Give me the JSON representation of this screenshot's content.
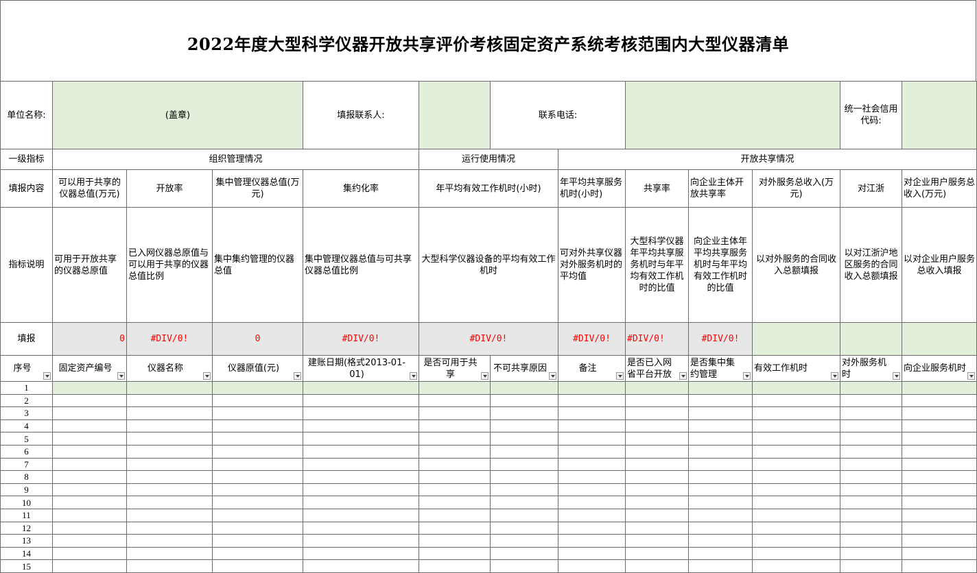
{
  "title": "2022年度大型科学仪器开放共享评价考核固定资产系统考核范围内大型仪器清单",
  "info_row": {
    "unit_label": "单位名称:",
    "stamp": "(盖章)",
    "contact_label": "填报联系人:",
    "phone_label": "联系电话:",
    "credit_label": "统一社会信用代码:"
  },
  "level1": {
    "label": "一级指标",
    "org": "组织管理情况",
    "ops": "运行使用情况",
    "share": "开放共享情况"
  },
  "content": {
    "label": "填报内容",
    "c1": "可以用于共享的仪器总值(万元)",
    "c2": "开放率",
    "c3": "集中管理仪器总值(万元)",
    "c4": "集约化率",
    "c5": "年平均有效工作机时(小时)",
    "c6": "年平均共享服务机时(小时)",
    "c7": "共享率",
    "c8": "向企业主体开放共享率",
    "c9": "对外服务总收入(万元)",
    "c10": "对江浙",
    "c11": "对企业用户服务总收入(万元)"
  },
  "explain": {
    "label": "指标说明",
    "c1": "可用于开放共享的仪器总原值",
    "c2": "已入网仪器总原值与可以用于共享的仪器总值比例",
    "c3": "集中集约管理的仪器总值",
    "c4": "集中管理仪器总值与可共享仪器总值比例",
    "c5": "大型科学仪器设备的平均有效工作机时",
    "c6": "可对外共享仪器对外服务机时的平均值",
    "c7": "大型科学仪器年平均共享服务机时与年平均有效工作机时的比值",
    "c8": "向企业主体年平均共享服务机时与年平均有效工作机时的比值",
    "c9": "以对外服务的合同收入总额填报",
    "c10": "以对江浙沪地区服务的合同收入总额填报",
    "c11": "以对企业用户服务总收入填报"
  },
  "fill": {
    "label": "填报",
    "c1": "0",
    "c2": "#DIV/0!",
    "c3": "0",
    "c4": "#DIV/0!",
    "c5": "#DIV/0!",
    "c6": "#DIV/0!",
    "c7": "#DIV/0!",
    "c8": "#DIV/0!"
  },
  "columns": {
    "seq": "序号",
    "asset_no": "固定资产编号",
    "name": "仪器名称",
    "value": "仪器原值(元)",
    "date": "建账日期(格式2013-01-01)",
    "shareable": "是否可用于共享",
    "reason": "不可共享原因",
    "remark": "备注",
    "network": "是否已入网省平台开放",
    "central": "是否集中集约管理",
    "hours": "有效工作机时",
    "ext_hours": "对外服务机时",
    "ent_hours": "向企业服务机时"
  },
  "rows": [
    "1",
    "2",
    "3",
    "4",
    "5",
    "6",
    "7",
    "8",
    "9",
    "10",
    "11",
    "12",
    "13",
    "14",
    "15"
  ]
}
